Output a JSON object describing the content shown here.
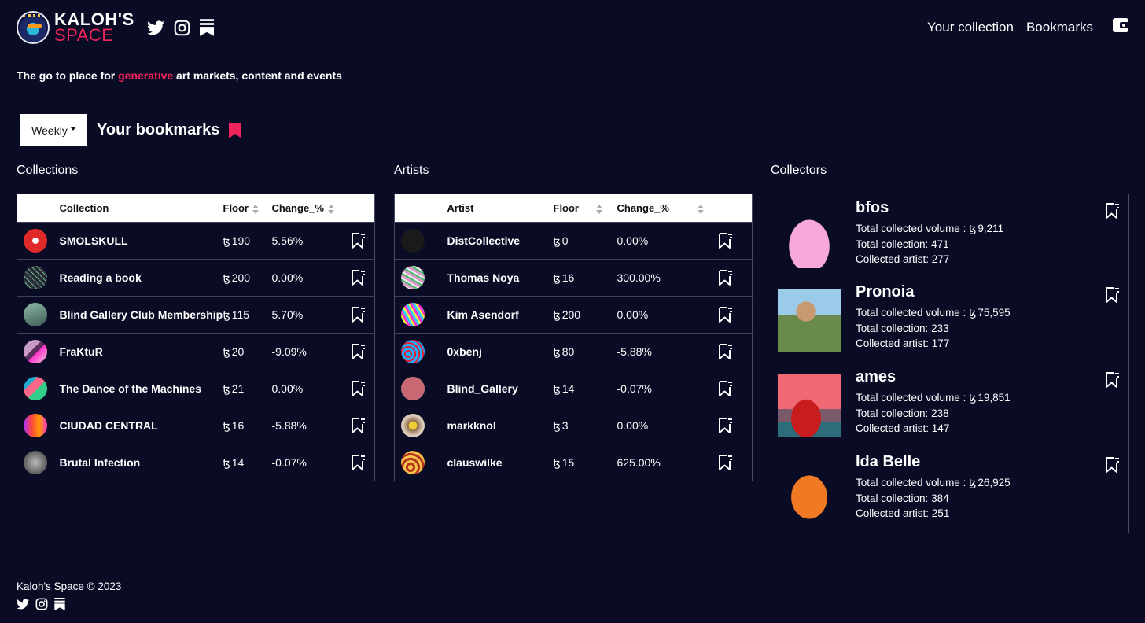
{
  "brand": {
    "line1": "KALOH'S",
    "line2": "SPACE",
    "accent_color": "#f0245a",
    "background_color": "#0a0b24"
  },
  "header": {
    "social_icons": [
      "twitter-icon",
      "instagram-icon",
      "substack-icon"
    ],
    "nav": [
      {
        "label": "Your collection"
      },
      {
        "label": "Bookmarks"
      }
    ],
    "wallet_icon": "wallet-icon"
  },
  "tagline": {
    "before": "The go to place for ",
    "highlight": "generative",
    "after": " art markets, content and events"
  },
  "bookmarks": {
    "period_selected": "Weekly",
    "title": "Your bookmarks"
  },
  "currency_symbol": "ꜩ",
  "collections": {
    "title": "Collections",
    "headers": {
      "name": "Collection",
      "floor": "Floor",
      "change": "Change_%"
    },
    "rows": [
      {
        "name": "SMOLSKULL",
        "floor": "190",
        "change": "5.56%"
      },
      {
        "name": "Reading a book",
        "floor": "200",
        "change": "0.00%"
      },
      {
        "name": "Blind Gallery Club Membership",
        "floor": "115",
        "change": "5.70%"
      },
      {
        "name": "FraKtuR",
        "floor": "20",
        "change": "-9.09%"
      },
      {
        "name": "The Dance of the Machines",
        "floor": "21",
        "change": "0.00%"
      },
      {
        "name": "CIUDAD CENTRAL",
        "floor": "16",
        "change": "-5.88%"
      },
      {
        "name": "Brutal Infection",
        "floor": "14",
        "change": "-0.07%"
      }
    ]
  },
  "artists": {
    "title": "Artists",
    "headers": {
      "name": "Artist",
      "floor": "Floor",
      "change": "Change_%"
    },
    "rows": [
      {
        "name": "DistCollective",
        "floor": "0",
        "change": "0.00%"
      },
      {
        "name": "Thomas Noya",
        "floor": "16",
        "change": "300.00%"
      },
      {
        "name": "Kim Asendorf",
        "floor": "200",
        "change": "0.00%"
      },
      {
        "name": "0xbenj",
        "floor": "80",
        "change": "-5.88%"
      },
      {
        "name": "Blind_Gallery",
        "floor": "14",
        "change": "-0.07%"
      },
      {
        "name": "markknol",
        "floor": "3",
        "change": "0.00%"
      },
      {
        "name": "clauswilke",
        "floor": "15",
        "change": "625.00%"
      }
    ]
  },
  "collectors": {
    "title": "Collectors",
    "volume_label": "Total collected volume : ",
    "collection_label": "Total collection: ",
    "artist_label": "Collected artist: ",
    "items": [
      {
        "name": "bfos",
        "volume": "9,211",
        "total_collection": "471",
        "collected_artist": "277"
      },
      {
        "name": "Pronoia",
        "volume": "75,595",
        "total_collection": "233",
        "collected_artist": "177"
      },
      {
        "name": "ames",
        "volume": "19,851",
        "total_collection": "238",
        "collected_artist": "147"
      },
      {
        "name": "Ida Belle",
        "volume": "26,925",
        "total_collection": "384",
        "collected_artist": "251"
      }
    ]
  },
  "footer": {
    "copyright": "Kaloh's Space © 2023"
  }
}
